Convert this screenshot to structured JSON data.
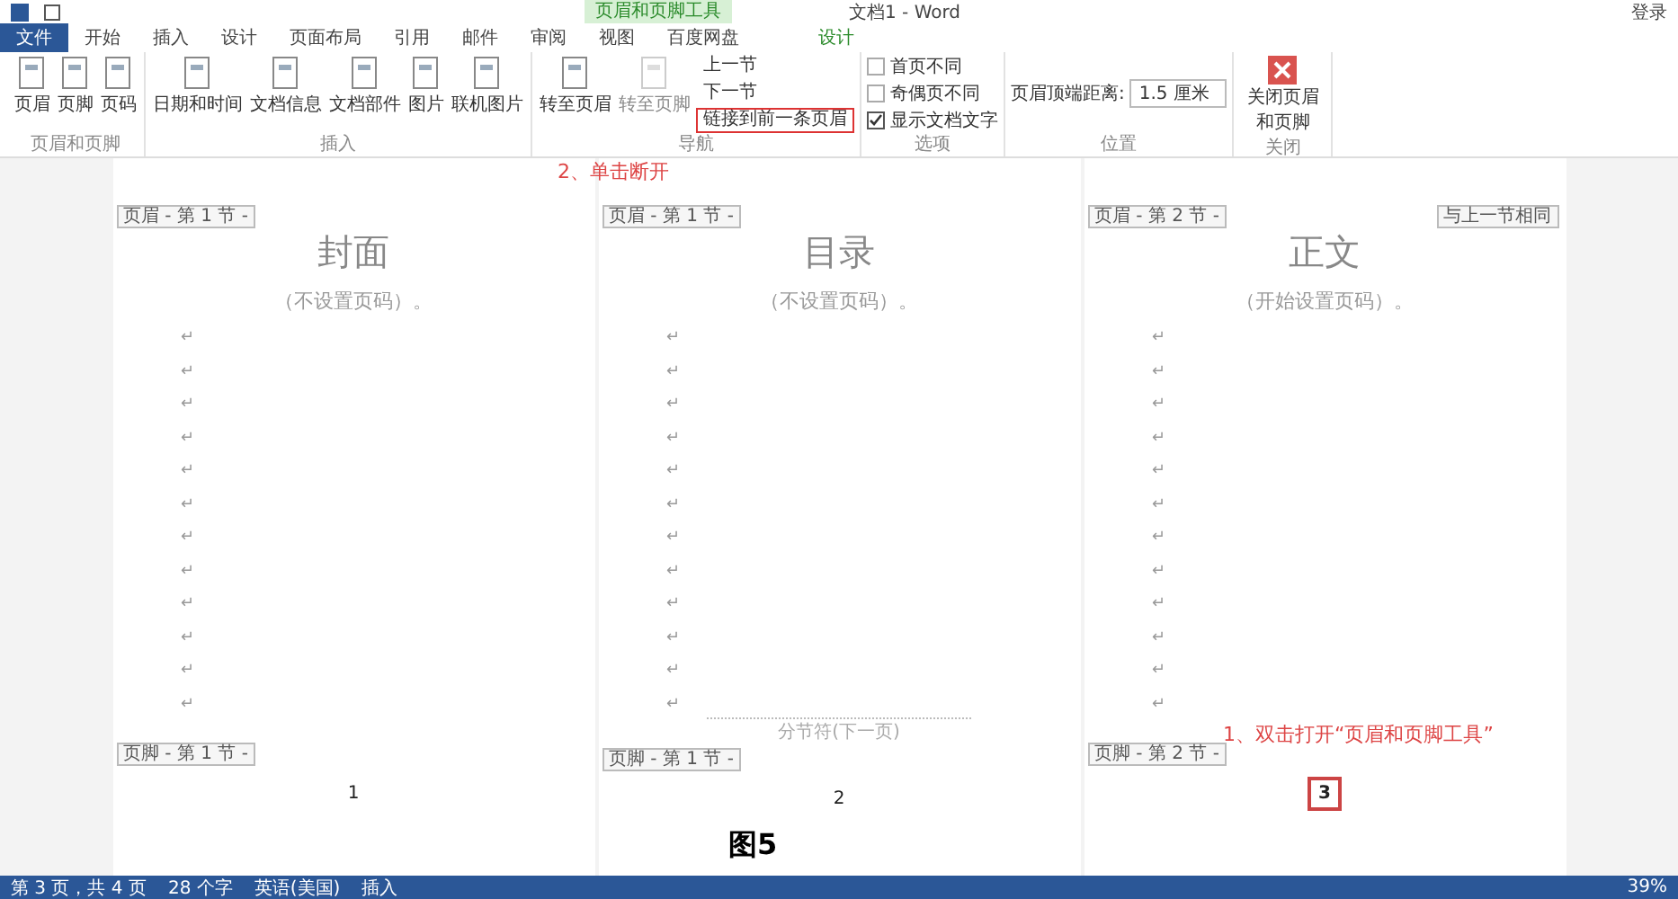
{
  "window": {
    "title": "文档1 - Word",
    "context_tab_group": "页眉和页脚工具",
    "sign_in": "登录"
  },
  "tabs": [
    {
      "label": "文件",
      "selected": true,
      "kind": "file"
    },
    {
      "label": "开始",
      "selected": false,
      "kind": "normal"
    },
    {
      "label": "插入",
      "selected": false,
      "kind": "normal"
    },
    {
      "label": "设计",
      "selected": false,
      "kind": "normal"
    },
    {
      "label": "页面布局",
      "selected": false,
      "kind": "normal"
    },
    {
      "label": "引用",
      "selected": false,
      "kind": "normal"
    },
    {
      "label": "邮件",
      "selected": false,
      "kind": "normal"
    },
    {
      "label": "审阅",
      "selected": false,
      "kind": "normal"
    },
    {
      "label": "视图",
      "selected": false,
      "kind": "normal"
    },
    {
      "label": "百度网盘",
      "selected": false,
      "kind": "normal"
    },
    {
      "label": "设计",
      "selected": false,
      "kind": "context"
    }
  ],
  "ribbon": [
    {
      "label": "页眉和页脚",
      "items": [
        {
          "kind": "big",
          "label": "页眉",
          "disabled": false
        },
        {
          "kind": "big",
          "label": "页脚",
          "disabled": false
        },
        {
          "kind": "big",
          "label": "页码",
          "disabled": false
        }
      ]
    },
    {
      "label": "插入",
      "items": [
        {
          "kind": "big",
          "label": "日期和时间",
          "disabled": false
        },
        {
          "kind": "big",
          "label": "文档信息",
          "disabled": false
        },
        {
          "kind": "big",
          "label": "文档部件",
          "disabled": false
        },
        {
          "kind": "big",
          "label": "图片",
          "disabled": false
        },
        {
          "kind": "big",
          "label": "联机图片",
          "disabled": false
        }
      ]
    },
    {
      "label": "导航",
      "items": [
        {
          "kind": "big",
          "label": "转至页眉",
          "disabled": false
        },
        {
          "kind": "big",
          "label": "转至页脚",
          "disabled": true
        },
        {
          "kind": "small",
          "label": "上一节",
          "disabled": false,
          "highlighted": false
        },
        {
          "kind": "small",
          "label": "下一节",
          "disabled": false,
          "highlighted": false
        },
        {
          "kind": "small",
          "label": "链接到前一条页眉",
          "disabled": false,
          "highlighted": true
        }
      ]
    },
    {
      "label": "选项",
      "items": [
        {
          "kind": "check",
          "label": "首页不同",
          "checked": false
        },
        {
          "kind": "check",
          "label": "奇偶页不同",
          "checked": false
        },
        {
          "kind": "check",
          "label": "显示文档文字",
          "checked": true
        }
      ]
    },
    {
      "label": "位置",
      "items": [
        {
          "kind": "spin",
          "label": "页眉顶端距离:",
          "value": "1.5 厘米"
        }
      ]
    },
    {
      "label": "关闭",
      "items": [
        {
          "kind": "close",
          "label": "关闭页眉和页脚"
        }
      ]
    }
  ],
  "annotations": [
    {
      "text": "2、单击断开"
    },
    {
      "text": "1、双击打开“页眉和页脚工具”"
    }
  ],
  "pages": [
    {
      "header_tag": "页眉 - 第 1 节 -",
      "title": "封面",
      "note": "（不设置页码）。",
      "marks": [
        "↵",
        "↵",
        "↵",
        "↵",
        "↵",
        "↵",
        "↵",
        "↵",
        "↵",
        "↵",
        "↵",
        "↵"
      ],
      "footer_tag": "页脚 - 第 1 节 -",
      "page_number": "1",
      "number_boxed": false
    },
    {
      "header_tag": "页眉 - 第 1 节 -",
      "title": "目录",
      "note": "（不设置页码）。",
      "marks": [
        "↵",
        "↵",
        "↵",
        "↵",
        "↵",
        "↵",
        "↵",
        "↵",
        "↵",
        "↵",
        "↵",
        "↵"
      ],
      "section_break": "分节符(下一页)",
      "footer_tag": "页脚 - 第 1 节 -",
      "page_number": "2",
      "number_boxed": false
    },
    {
      "header_tag": "页眉 - 第 2 节 -",
      "same_as_previous": "与上一节相同",
      "title": "正文",
      "note": "（开始设置页码）。",
      "marks": [
        "↵",
        "↵",
        "↵",
        "↵",
        "↵",
        "↵",
        "↵",
        "↵",
        "↵",
        "↵",
        "↵",
        "↵"
      ],
      "footer_tag": "页脚 - 第 2 节 -",
      "page_number": "3",
      "number_boxed": true
    }
  ],
  "caption": "图5",
  "status_bar": {
    "page": "第 3 页，共 4 页",
    "words": "28 个字",
    "language": "英语(美国)",
    "mode": "插入",
    "zoom": "39%"
  }
}
